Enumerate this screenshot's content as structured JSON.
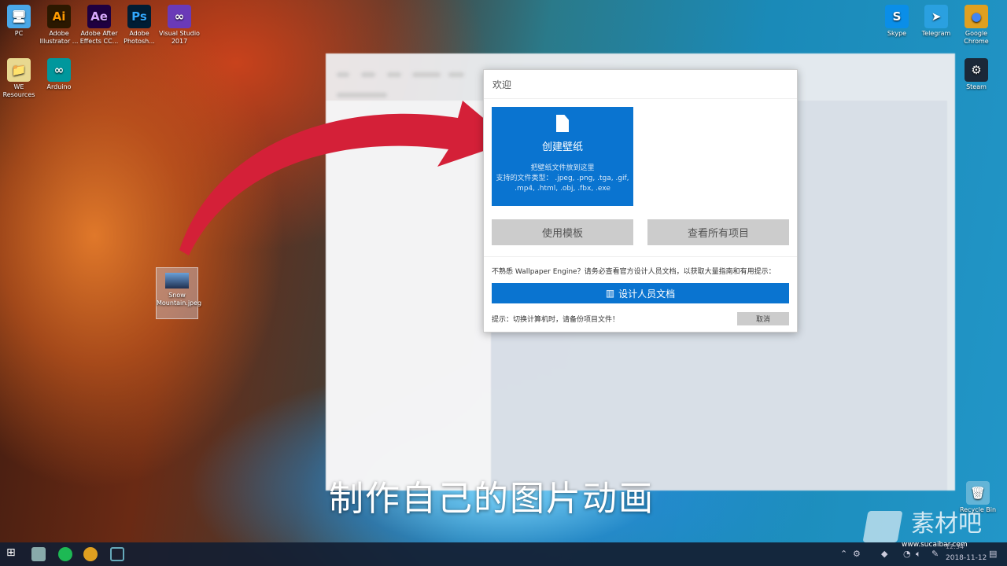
{
  "desktop_icons_left": [
    {
      "label": "PC",
      "glyph": "🖥",
      "color": "#4aa8e8"
    },
    {
      "label": "Adobe Illustrator ...",
      "glyph": "Ai",
      "color": "#2b1800",
      "fg": "#ff9a00"
    },
    {
      "label": "Adobe After Effects CC...",
      "glyph": "Ae",
      "color": "#1f0040",
      "fg": "#d8a8ff"
    },
    {
      "label": "Adobe Photosh...",
      "glyph": "Ps",
      "color": "#001d34",
      "fg": "#31a8ff"
    },
    {
      "label": "Visual Studio 2017",
      "glyph": "∞",
      "color": "#6a3ab8",
      "fg": "#fff"
    },
    {
      "label": "WE Resources",
      "glyph": "📁",
      "color": "#e8d890"
    },
    {
      "label": "Arduino",
      "glyph": "∞",
      "color": "#00979c",
      "fg": "#fff"
    }
  ],
  "desktop_icons_right": [
    {
      "label": "Skype",
      "glyph": "S",
      "color": "#0a8ee8",
      "fg": "#fff"
    },
    {
      "label": "Telegram",
      "glyph": "➤",
      "color": "#2aa0e0",
      "fg": "#fff"
    },
    {
      "label": "Google Chrome",
      "glyph": "●",
      "color": "#e0a020",
      "fg": "#4285f4"
    },
    {
      "label": "Steam",
      "glyph": "⚙",
      "color": "#1b2838",
      "fg": "#fff"
    }
  ],
  "dragged_file": {
    "label": "Snow Mountain.jpeg"
  },
  "recycle_bin": {
    "label": "Recycle Bin"
  },
  "dialog": {
    "title": "欢迎",
    "create": {
      "title": "创建壁纸",
      "line1": "把壁纸文件放到这里",
      "line2": "支持的文件类型： .jpeg, .png, .tga, .gif,",
      "line3": ".mp4, .html, .obj, .fbx, .exe"
    },
    "template_button": "使用模板",
    "view_all_button": "查看所有项目",
    "info": "不熟悉 Wallpaper Engine？请务必查看官方设计人员文档，以获取大量指南和有用提示：",
    "docs_button": "设计人员文档",
    "tip": "提示：切换计算机时，请备份项目文件！",
    "cancel_button": "取消"
  },
  "subtitle": "制作自己的图片动画",
  "watermark": {
    "brand": "素材吧",
    "url": "www.sucaibar.com"
  },
  "taskbar": {
    "time": "12:34",
    "date": "2018-11-12"
  },
  "colors": {
    "accent": "#0a74d0",
    "arrow": "#d42038"
  }
}
